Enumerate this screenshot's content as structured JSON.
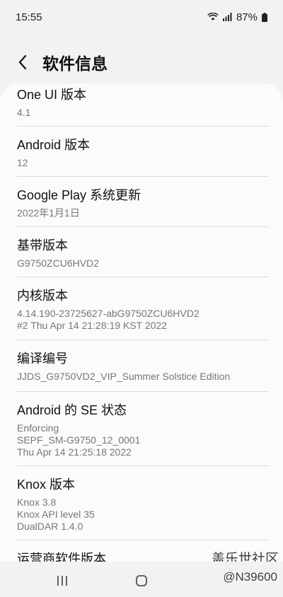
{
  "status_bar": {
    "time": "15:55",
    "battery": "87%"
  },
  "header": {
    "title": "软件信息"
  },
  "items": [
    {
      "title": "One UI 版本",
      "values": [
        "4.1"
      ]
    },
    {
      "title": "Android 版本",
      "values": [
        "12"
      ]
    },
    {
      "title": "Google Play 系统更新",
      "values": [
        "2022年1月1日"
      ]
    },
    {
      "title": "基带版本",
      "values": [
        "G9750ZCU6HVD2"
      ]
    },
    {
      "title": "内核版本",
      "values": [
        "4.14.190-23725627-abG9750ZCU6HVD2",
        "#2 Thu Apr 14 21:28:19 KST 2022"
      ]
    },
    {
      "title": "编译编号",
      "values": [
        "JJDS_G9750VD2_VIP_Summer Solstice Edition"
      ]
    },
    {
      "title": "Android 的 SE 状态",
      "values": [
        "Enforcing",
        "SEPF_SM-G9750_12_0001",
        "Thu Apr 14 21:25:18 2022"
      ]
    },
    {
      "title": "Knox 版本",
      "values": [
        "Knox 3.8",
        "Knox API level 35",
        "DualDAR 1.4.0"
      ]
    },
    {
      "title": "运营商软件版本",
      "values": []
    }
  ],
  "watermark": {
    "title": "盖乐世社区",
    "handle": "@N39600"
  }
}
